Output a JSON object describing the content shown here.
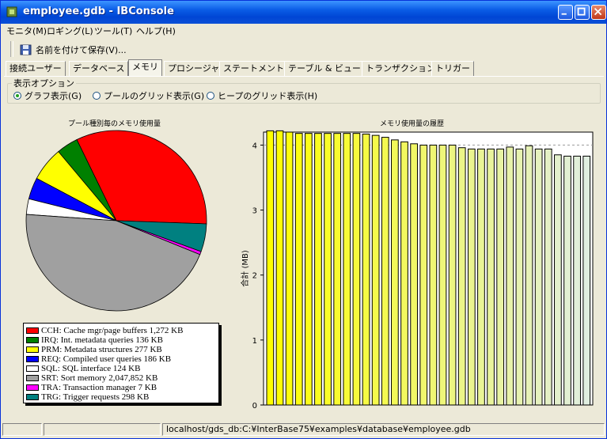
{
  "window": {
    "title": "employee.gdb - IBConsole"
  },
  "menu": [
    {
      "label": "モニタ(M)"
    },
    {
      "label": "ロギング(L)"
    },
    {
      "label": "ツール(T)"
    },
    {
      "label": "ヘルプ(H)"
    }
  ],
  "toolbar": {
    "save_as_label": "名前を付けて保存(V)..."
  },
  "tabs": [
    {
      "label": "接続ユーザー"
    },
    {
      "label": "データベース"
    },
    {
      "label": "メモリ",
      "active": true
    },
    {
      "label": "プロシージャ"
    },
    {
      "label": "ステートメント"
    },
    {
      "label": "テーブル & ビュー"
    },
    {
      "label": "トランザクション"
    },
    {
      "label": "トリガー"
    }
  ],
  "display_options": {
    "legend": "表示オプション",
    "options": [
      {
        "label": "グラフ表示(G)",
        "selected": true
      },
      {
        "label": "プールのグリッド表示(G)",
        "selected": false
      },
      {
        "label": "ヒープのグリッド表示(H)",
        "selected": false
      }
    ]
  },
  "chart_data": [
    {
      "type": "pie",
      "title": "プール種別毎のメモリ使用量",
      "slices": [
        {
          "label": "CCH: Cache mgr/page buffers 1,272 KB",
          "value": 1272,
          "color": "#ff0000"
        },
        {
          "label": "IRQ: Int. metadata queries 136 KB",
          "value": 136,
          "color": "#008000"
        },
        {
          "label": "PRM: Metadata structures 277 KB",
          "value": 277,
          "color": "#ffff00"
        },
        {
          "label": "REQ: Compiled user queries 186 KB",
          "value": 186,
          "color": "#0000ff"
        },
        {
          "label": "SQL: SQL interface 124 KB",
          "value": 124,
          "color": "#ffffff"
        },
        {
          "label": "SRT: Sort memory 2,047,852 KB",
          "value": 2047852,
          "color": "#a0a0a0"
        },
        {
          "label": "TRA: Transaction manager 7 KB",
          "value": 7,
          "color": "#ff00ff"
        },
        {
          "label": "TRG: Trigger requests 298 KB",
          "value": 298,
          "color": "#008080"
        }
      ]
    },
    {
      "type": "bar",
      "title": "メモリ使用量の履歴",
      "ylabel": "合計 (MB)",
      "ylim": [
        0,
        4.2
      ],
      "yticks": [
        "0",
        "1",
        "2",
        "3",
        "4"
      ],
      "values": [
        4.22,
        4.22,
        4.2,
        4.18,
        4.18,
        4.18,
        4.18,
        4.18,
        4.18,
        4.18,
        4.17,
        4.15,
        4.12,
        4.08,
        4.05,
        4.02,
        4.0,
        4.0,
        4.0,
        4.0,
        3.96,
        3.94,
        3.94,
        3.94,
        3.94,
        3.97,
        3.94,
        3.99,
        3.94,
        3.94,
        3.85,
        3.83,
        3.83,
        3.83
      ]
    }
  ],
  "statusbar": {
    "path": "localhost/gds_db:C:¥InterBase75¥examples¥database¥employee.gdb"
  }
}
